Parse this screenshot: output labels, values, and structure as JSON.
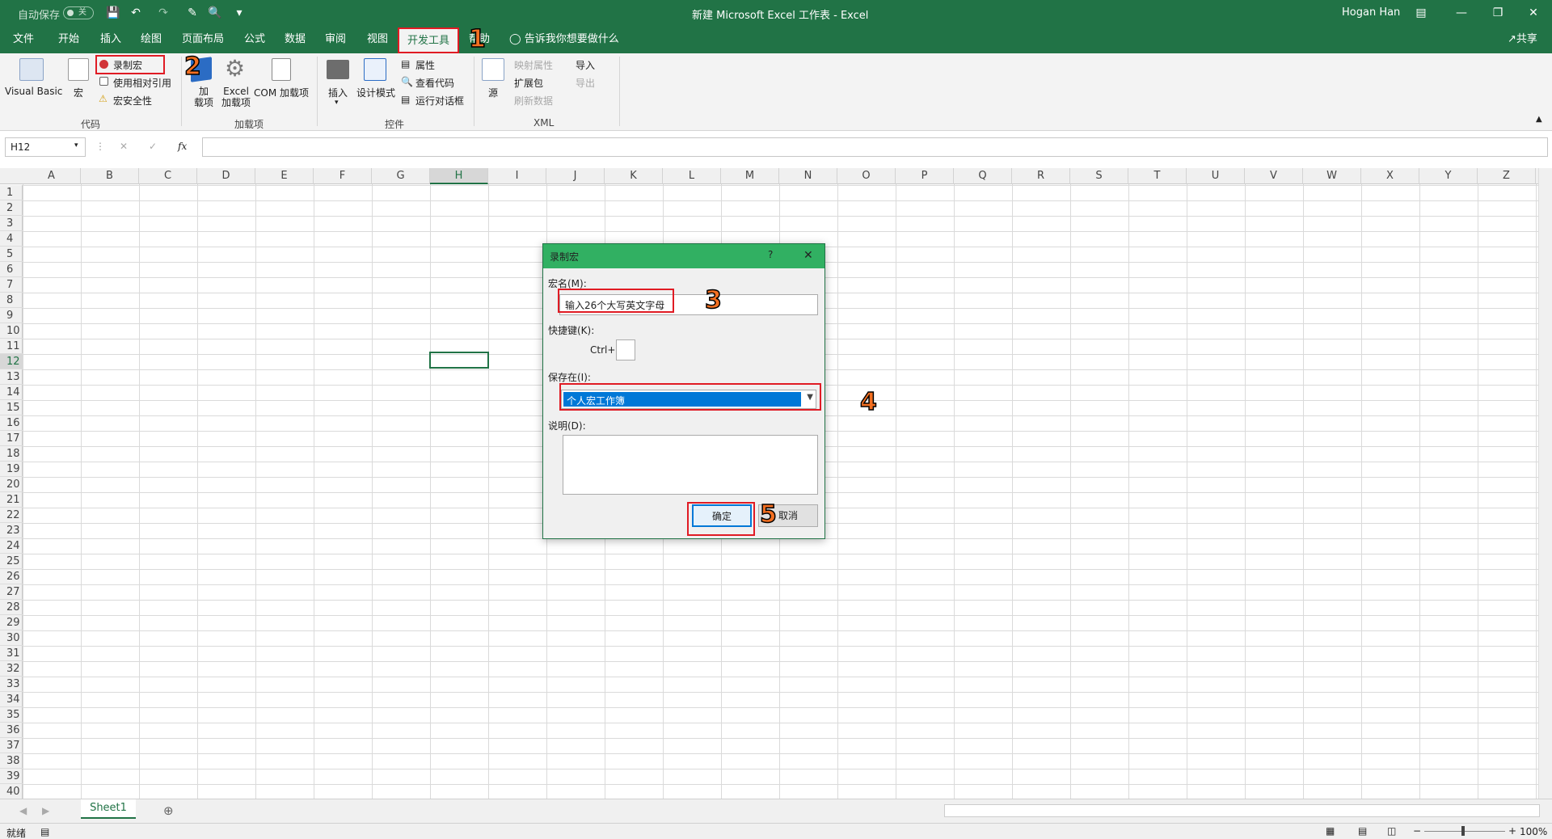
{
  "window": {
    "title": "新建 Microsoft Excel 工作表  -  Excel",
    "user": "Hogan Han",
    "autosave_label": "自动保存",
    "autosave_state": "关",
    "share": "共享"
  },
  "tabs": [
    "文件",
    "开始",
    "插入",
    "绘图",
    "页面布局",
    "公式",
    "数据",
    "审阅",
    "视图",
    "开发工具",
    "帮助"
  ],
  "tell_me": "告诉我你想要做什么",
  "ribbon": {
    "code": {
      "visual_basic": "Visual Basic",
      "macros": "宏",
      "record_macro": "录制宏",
      "relative_ref": "使用相对引用",
      "macro_security": "宏安全性",
      "group": "代码"
    },
    "addins": {
      "addins": "加\n载项",
      "excel_addins": "Excel\n加载项",
      "com_addins": "COM 加载项",
      "group": "加载项"
    },
    "controls": {
      "insert": "插入",
      "design_mode": "设计模式",
      "properties": "属性",
      "view_code": "查看代码",
      "run_dialog": "运行对话框",
      "group": "控件"
    },
    "xml": {
      "source": "源",
      "map_props": "映射属性",
      "expansion": "扩展包",
      "refresh": "刷新数据",
      "import": "导入",
      "export": "导出",
      "group": "XML"
    }
  },
  "formula_bar": {
    "name_box": "H12",
    "value": ""
  },
  "columns": [
    "A",
    "B",
    "C",
    "D",
    "E",
    "F",
    "G",
    "H",
    "I",
    "J",
    "K",
    "L",
    "M",
    "N",
    "O",
    "P",
    "Q",
    "R",
    "S",
    "T",
    "U",
    "V",
    "W",
    "X",
    "Y",
    "Z"
  ],
  "rows": [
    "1",
    "2",
    "3",
    "4",
    "5",
    "6",
    "7",
    "8",
    "9",
    "10",
    "11",
    "12",
    "13",
    "14",
    "15",
    "16",
    "17",
    "18",
    "19",
    "20",
    "21",
    "22",
    "23",
    "24",
    "25",
    "26",
    "27",
    "28",
    "29",
    "30",
    "31",
    "32",
    "33",
    "34",
    "35",
    "36",
    "37",
    "38",
    "39",
    "40"
  ],
  "selected": {
    "column": "H",
    "row": "12"
  },
  "sheet_tab": "Sheet1",
  "status": {
    "ready": "就绪",
    "zoom": "100%"
  },
  "dialog": {
    "title": "录制宏",
    "help": "?",
    "close": "✕",
    "macro_name_label": "宏名(M):",
    "macro_name_value": "输入26个大写英文字母",
    "shortcut_label": "快捷键(K):",
    "ctrl_label": "Ctrl+",
    "store_label": "保存在(I):",
    "store_value": "个人宏工作簿",
    "desc_label": "说明(D):",
    "ok": "确定",
    "cancel": "取消"
  },
  "annotations": [
    "1",
    "2",
    "3",
    "4",
    "5"
  ],
  "colors": {
    "accent": "#217346",
    "dialog_title": "#31b062",
    "highlight": "#e01b24",
    "badge": "#f36f21",
    "selection": "#0078d7"
  }
}
